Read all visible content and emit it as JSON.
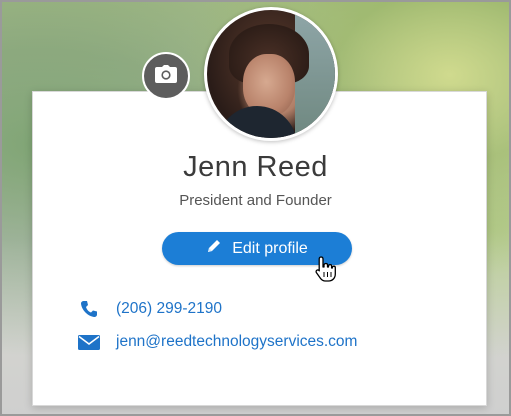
{
  "profile": {
    "name": "Jenn Reed",
    "job_title": "President and Founder",
    "edit_label": "Edit profile",
    "phone": "(206) 299-2190",
    "email": "jenn@reedtechnologyservices.com"
  },
  "icons": {
    "camera": "camera-icon",
    "pencil": "pencil-icon",
    "phone": "phone-icon",
    "email": "mail-icon",
    "cursor": "hand-cursor-icon"
  },
  "colors": {
    "accent": "#1c7ed6",
    "link": "#1e73c8",
    "camera_button": "#5d5d5d"
  }
}
